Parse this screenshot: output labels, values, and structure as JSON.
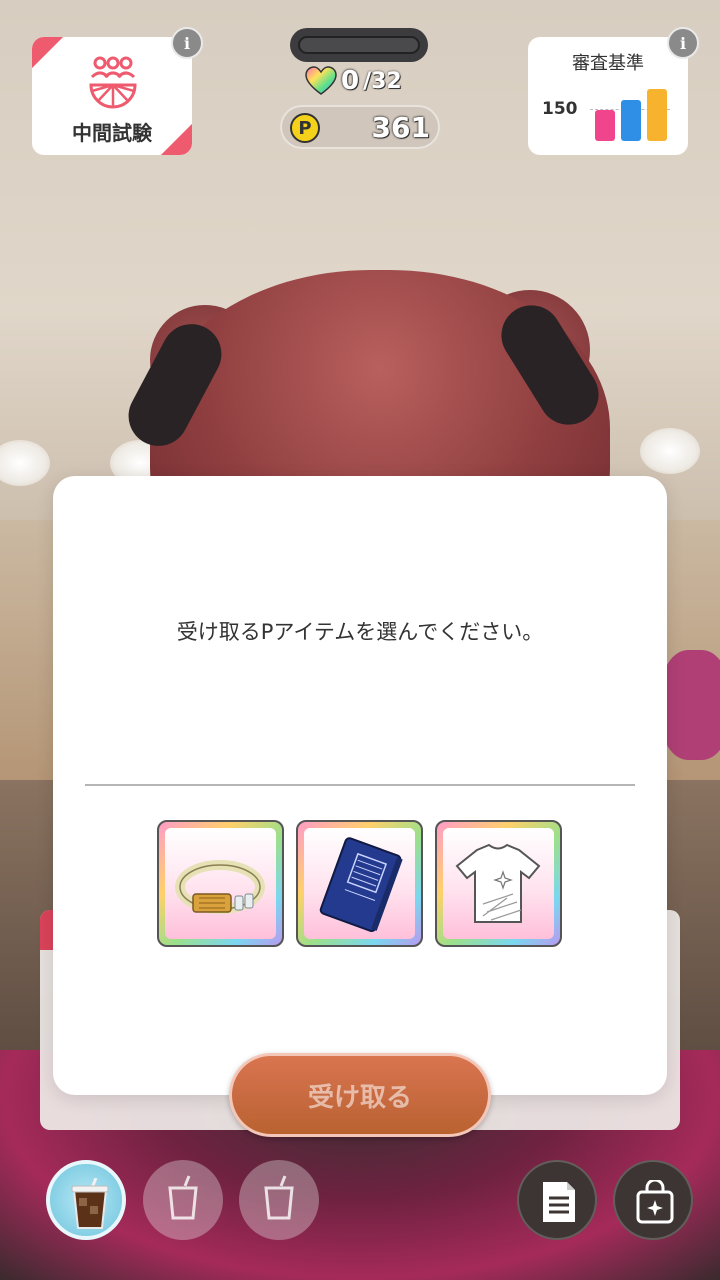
{
  "exam": {
    "label": "中間試験"
  },
  "criteria": {
    "title": "審査基準",
    "score": "150",
    "bars": [
      {
        "color": "#f0458c",
        "level": 0.6
      },
      {
        "color": "#2f8fe6",
        "level": 0.78
      },
      {
        "color": "#f7b22e",
        "level": 1.0
      }
    ]
  },
  "status": {
    "hearts": "0",
    "hearts_max": "/32",
    "points": "361"
  },
  "dialog": {
    "message": "受け取るPアイテムを選んでください。",
    "items": [
      {
        "icon": "bracelet-icon"
      },
      {
        "icon": "notebook-icon"
      },
      {
        "icon": "tshirt-icon"
      }
    ],
    "receive_label": "受け取る"
  },
  "toolbar": {
    "drinks": [
      "iced-coffee-icon",
      "empty-drink-slot-icon",
      "empty-drink-slot-icon"
    ],
    "buttons": [
      "deck-list-icon",
      "item-bag-icon"
    ]
  },
  "colors": {
    "accent_red": "#ef5b6e",
    "receive_button": "#c6693f"
  }
}
